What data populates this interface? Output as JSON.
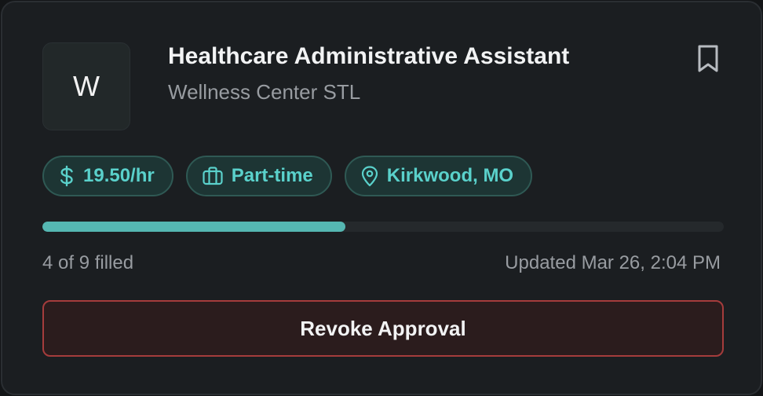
{
  "job": {
    "logo_letter": "W",
    "title": "Healthcare Administrative Assistant",
    "company": "Wellness Center STL",
    "bookmark_icon": "bookmark-icon"
  },
  "tags": [
    {
      "icon": "dollar-icon",
      "label": "19.50/hr"
    },
    {
      "icon": "briefcase-icon",
      "label": "Part-time"
    },
    {
      "icon": "map-pin-icon",
      "label": "Kirkwood, MO"
    }
  ],
  "progress": {
    "filled": 4,
    "total": 9,
    "label": "4 of 9 filled",
    "updated": "Updated Mar 26, 2:04 PM"
  },
  "actions": {
    "revoke_label": "Revoke Approval"
  },
  "colors": {
    "accent": "#5ad1cb",
    "progress_fill": "#55b7b2",
    "danger_border": "#a53c3c",
    "card_bg": "#1b1e21"
  }
}
